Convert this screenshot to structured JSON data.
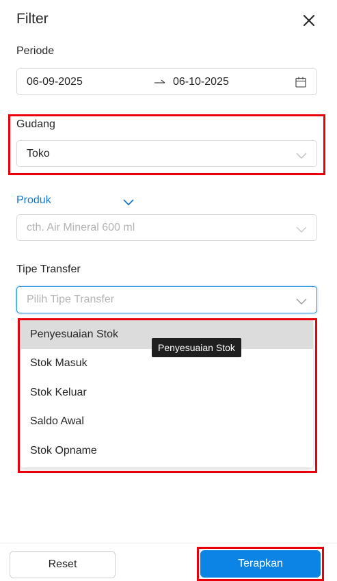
{
  "header": {
    "title": "Filter"
  },
  "periode": {
    "label": "Periode",
    "start": "06-09-2025",
    "end": "06-10-2025"
  },
  "gudang": {
    "label": "Gudang",
    "value": "Toko"
  },
  "produk": {
    "label": "Produk",
    "placeholder": "cth. Air Mineral 600 ml"
  },
  "tipe_transfer": {
    "label": "Tipe Transfer",
    "placeholder": "Pilih Tipe Transfer",
    "options": [
      "Penyesuaian Stok",
      "Stok Masuk",
      "Stok Keluar",
      "Saldo Awal",
      "Stok Opname"
    ],
    "tooltip": "Penyesuaian Stok"
  },
  "footer": {
    "reset_label": "Reset",
    "apply_label": "Terapkan"
  },
  "colors": {
    "accent": "#0b84e6",
    "highlight": "#e8000b",
    "link": "#1677c9"
  }
}
